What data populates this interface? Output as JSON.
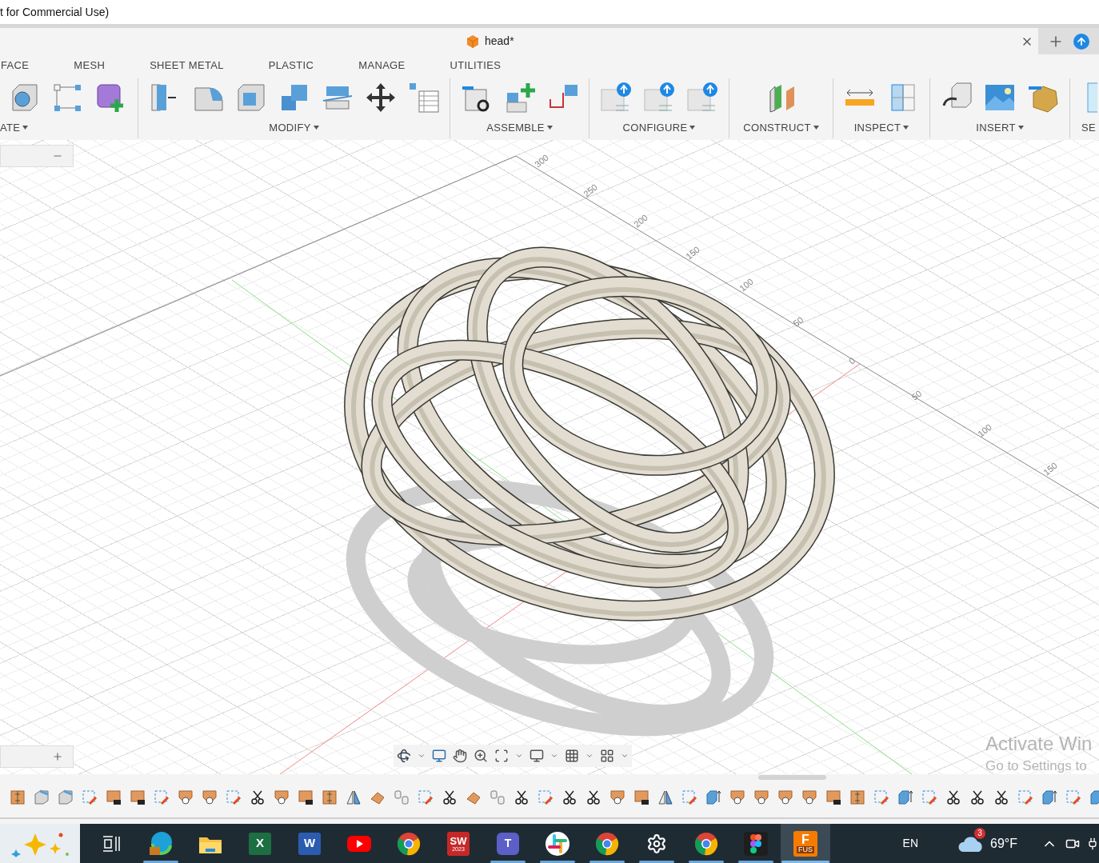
{
  "window": {
    "title": "t for Commercial Use)"
  },
  "document_tab": {
    "title": "head*"
  },
  "tabs": [
    {
      "label": "FACE",
      "selected": false
    },
    {
      "label": "MESH",
      "selected": false
    },
    {
      "label": "SHEET METAL",
      "selected": false
    },
    {
      "label": "PLASTIC",
      "selected": false
    },
    {
      "label": "MANAGE",
      "selected": false
    },
    {
      "label": "UTILITIES",
      "selected": false
    }
  ],
  "toolbar_groups": [
    {
      "label": "ATE",
      "dropdown": true
    },
    {
      "label": "MODIFY",
      "dropdown": true
    },
    {
      "label": "ASSEMBLE",
      "dropdown": true
    },
    {
      "label": "CONFIGURE",
      "dropdown": true
    },
    {
      "label": "CONSTRUCT",
      "dropdown": true
    },
    {
      "label": "INSPECT",
      "dropdown": true
    },
    {
      "label": "INSERT",
      "dropdown": true
    },
    {
      "label": "SE",
      "dropdown": false
    }
  ],
  "ruler_labels": [
    "300",
    "250",
    "200",
    "150",
    "100",
    "50",
    "0",
    "50",
    "100",
    "150"
  ],
  "activation_notice": {
    "title": "Activate Win",
    "subtitle": "Go to Settings to"
  },
  "taskbar": {
    "apps": [
      {
        "kind": "taskview",
        "running": false,
        "selected": false
      },
      {
        "kind": "edge",
        "running": true,
        "selected": false
      },
      {
        "kind": "explorer",
        "running": false,
        "selected": false
      },
      {
        "kind": "excel",
        "label": "X",
        "running": false,
        "selected": false
      },
      {
        "kind": "word",
        "label": "W",
        "running": false,
        "selected": false
      },
      {
        "kind": "youtube",
        "running": false,
        "selected": false
      },
      {
        "kind": "chrome",
        "running": false,
        "selected": false
      },
      {
        "kind": "solidworks",
        "label": "SW",
        "sublabel": "2023",
        "running": false,
        "selected": false
      },
      {
        "kind": "teams",
        "label": "T",
        "running": true,
        "selected": false
      },
      {
        "kind": "slack",
        "running": true,
        "selected": false
      },
      {
        "kind": "chrome",
        "running": true,
        "selected": false
      },
      {
        "kind": "settings",
        "running": true,
        "selected": false
      },
      {
        "kind": "chrome",
        "running": true,
        "selected": false
      },
      {
        "kind": "figma",
        "running": true,
        "selected": false
      },
      {
        "kind": "fusion",
        "label": "F",
        "sublabel": "FUS",
        "running": true,
        "selected": true
      }
    ],
    "language": "EN",
    "weather_badge": "3",
    "temperature": "69°F"
  }
}
